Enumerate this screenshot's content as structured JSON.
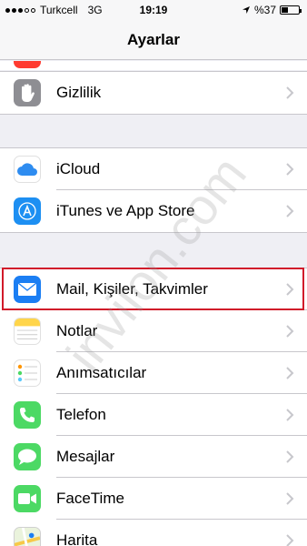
{
  "status_bar": {
    "carrier": "Turkcell",
    "network": "3G",
    "time": "19:19",
    "battery_text": "%37",
    "battery_level": 0.37
  },
  "nav": {
    "title": "Ayarlar"
  },
  "groups": [
    {
      "items": [
        {
          "label": "Gizlilik",
          "icon": "privacy-hand-icon",
          "color": "#8e8e93"
        }
      ]
    },
    {
      "items": [
        {
          "label": "iCloud",
          "icon": "icloud-icon",
          "color": "#ffffff"
        },
        {
          "label": "iTunes ve App Store",
          "icon": "app-store-icon",
          "color": "#1d8ff2"
        }
      ]
    },
    {
      "items": [
        {
          "label": "Mail, Kişiler, Takvimler",
          "icon": "mail-icon",
          "color": "#1b7ef3"
        },
        {
          "label": "Notlar",
          "icon": "notes-icon",
          "color": "#ffd54a"
        },
        {
          "label": "Anımsatıcılar",
          "icon": "reminders-icon",
          "color": "#ffffff"
        },
        {
          "label": "Telefon",
          "icon": "phone-icon",
          "color": "#4cd964"
        },
        {
          "label": "Mesajlar",
          "icon": "messages-icon",
          "color": "#4cd964"
        },
        {
          "label": "FaceTime",
          "icon": "facetime-icon",
          "color": "#4cd964"
        },
        {
          "label": "Harita",
          "icon": "maps-icon",
          "color": "#ffffff"
        }
      ]
    }
  ],
  "highlight_color": "#d11a2a",
  "watermark": "invilon.com"
}
